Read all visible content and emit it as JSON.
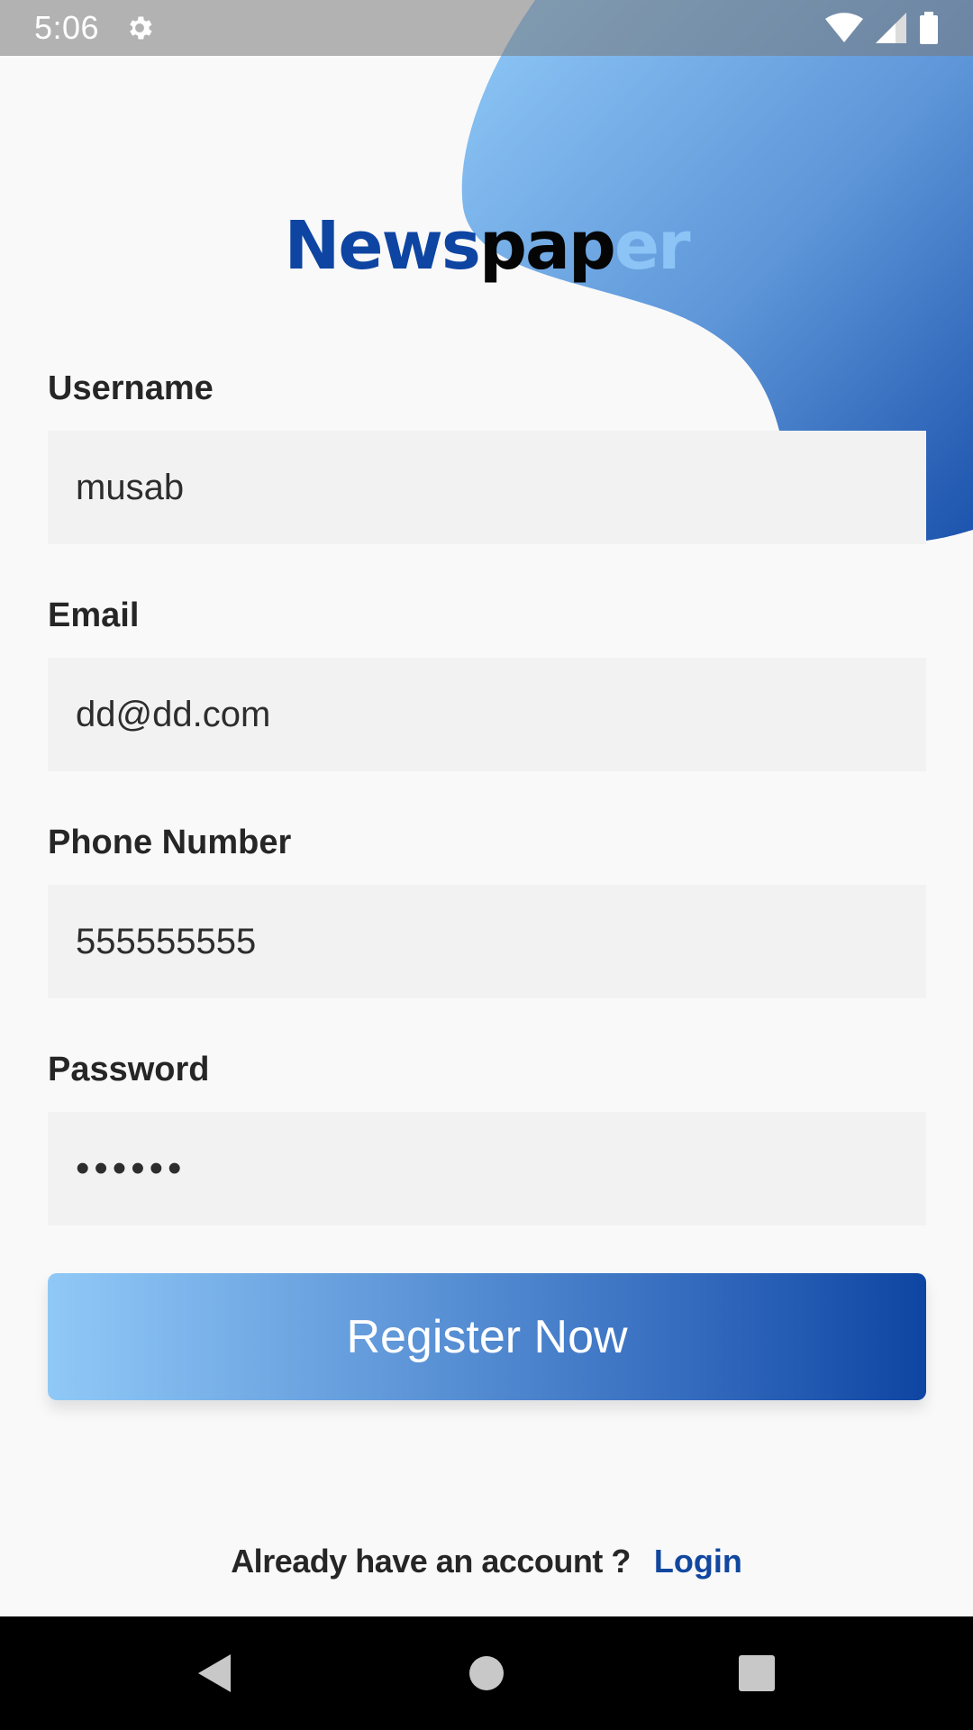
{
  "status_bar": {
    "time": "5:06",
    "icons": [
      "gear-icon",
      "wifi-icon",
      "signal-icon",
      "battery-icon"
    ]
  },
  "app": {
    "title_part1": "News",
    "title_part2": "pap",
    "title_part3": "er"
  },
  "form": {
    "username_label": "Username",
    "username_value": "musab",
    "email_label": "Email",
    "email_value": "dd@dd.com",
    "phone_label": "Phone Number",
    "phone_value": "555555555",
    "password_label": "Password",
    "password_value": "••••••",
    "register_label": "Register Now"
  },
  "footer": {
    "prompt": "Already have an account ?",
    "login_label": "Login"
  },
  "nav": {
    "icons": [
      "back-icon",
      "home-icon",
      "recents-icon"
    ]
  },
  "colors": {
    "brand_dark_blue": "#0e45a2",
    "brand_light_blue": "#90c9f7",
    "background": "#f9f9fa",
    "field_background": "#f2f2f3"
  }
}
